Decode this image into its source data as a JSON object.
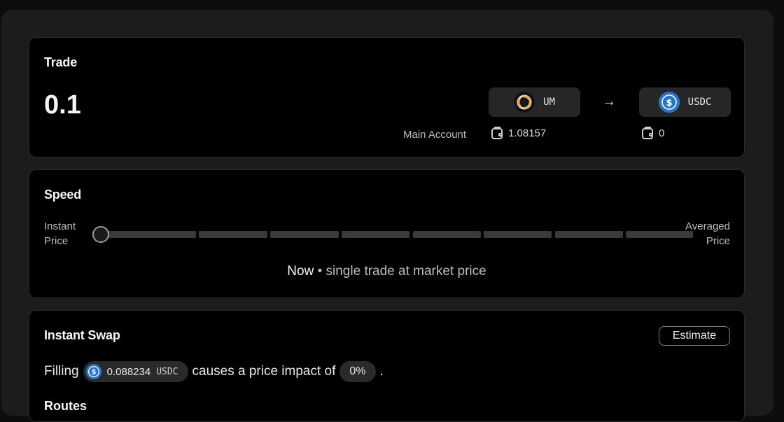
{
  "trade": {
    "title": "Trade",
    "amount": "0.1",
    "from_token": {
      "symbol": "UM",
      "icon": "penumbra-um-icon"
    },
    "to_token": {
      "symbol": "USDC",
      "icon": "usdc-icon"
    },
    "account_label": "Main Account",
    "from_balance": "1.08157",
    "to_balance": "0"
  },
  "speed": {
    "title": "Speed",
    "left_label_line1": "Instant",
    "left_label_line2": "Price",
    "right_label_line1": "Averaged",
    "right_label_line2": "Price",
    "desc_now": "Now",
    "desc_rest": " • single trade at market price",
    "slider_level": 0
  },
  "swap": {
    "title": "Instant Swap",
    "estimate_label": "Estimate",
    "filling_text": "Filling",
    "fill_amount": "0.088234",
    "fill_unit": "USDC",
    "impact_text": "causes a price impact of",
    "impact_value": "0%",
    "period": ".",
    "routes_title": "Routes"
  },
  "colors": {
    "background": "#0d0d0d",
    "card": "#000000",
    "usdc": "#2775ca",
    "um_ring": "#f0a040"
  }
}
